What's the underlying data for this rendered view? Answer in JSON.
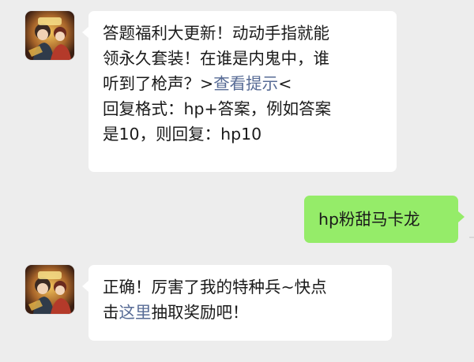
{
  "colors": {
    "background": "#ededed",
    "bubble_white": "#ffffff",
    "bubble_green": "#95ec69",
    "link": "#576b95"
  },
  "messages": [
    {
      "side": "left",
      "line1": "答题福利大更新！动动手指就能",
      "line2": "领永久套装！在谁是内鬼中，谁",
      "line3_pre": "听到了枪声？>",
      "line3_link": "查看提示",
      "line3_post": "<",
      "line4": "回复格式：hp+答案，例如答案",
      "line5": "是10，则回复：hp10"
    },
    {
      "side": "right",
      "text": "hp粉甜马卡龙"
    },
    {
      "side": "left",
      "line1": "正确！厉害了我的特种兵~快点",
      "line2_pre": "击",
      "line2_link": "这里",
      "line2_post": "抽取奖励吧！"
    }
  ],
  "avatar": {
    "icon": "game-character-avatar"
  }
}
